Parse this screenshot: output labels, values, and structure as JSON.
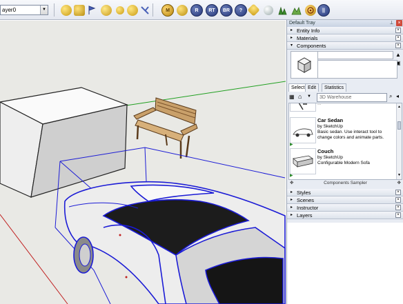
{
  "toolbar": {
    "layer_value": "ayer0",
    "view_buttons": [
      "M",
      "R",
      "RT",
      "BR"
    ]
  },
  "tray": {
    "title": "Default Tray",
    "panels_top": [
      {
        "label": "Entity Info",
        "arrow": "▸"
      },
      {
        "label": "Materials",
        "arrow": "▸"
      },
      {
        "label": "Components",
        "arrow": "▾"
      }
    ],
    "tabs": [
      "Select",
      "Edit",
      "Statistics"
    ],
    "search_placeholder": "3D Warehouse",
    "clipped_text": "...",
    "items": [
      {
        "title": "Car Sedan",
        "by": "by SketchUp",
        "desc": "Basic sedan.  Use interact tool to change colors and animate parts."
      },
      {
        "title": "Couch",
        "by": "by SketchUp",
        "desc": "Configurable Modern Sofa"
      }
    ],
    "sampler_label": "Components Sampler",
    "panels_bottom": [
      {
        "label": "Styles",
        "arrow": "▸"
      },
      {
        "label": "Scenes",
        "arrow": "▸"
      },
      {
        "label": "Instructor",
        "arrow": "▸"
      },
      {
        "label": "Layers",
        "arrow": "▸"
      }
    ]
  },
  "colors": {
    "selection_blue": "#1b1bd6",
    "axis_green": "#1f9f1f",
    "axis_red": "#c02020"
  }
}
